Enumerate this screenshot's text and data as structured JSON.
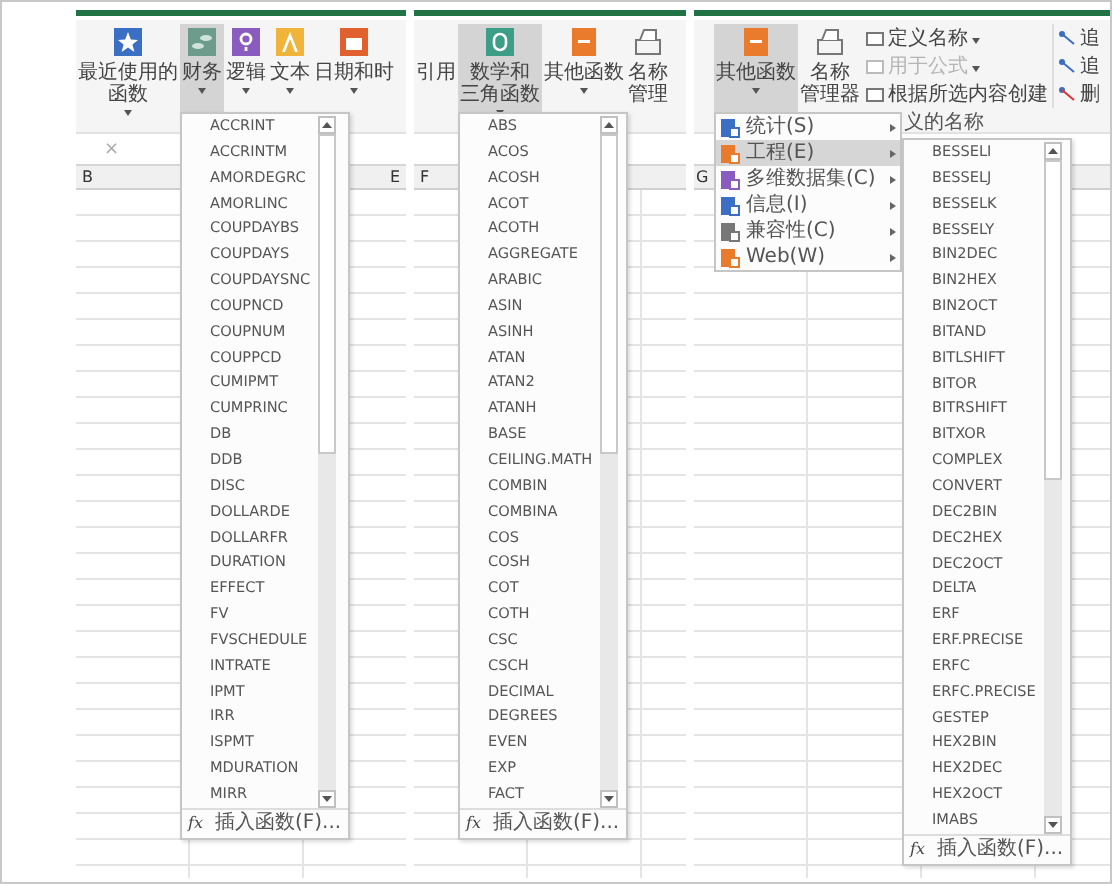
{
  "panels": [
    {
      "ribbon": {
        "buttons": [
          {
            "kind": "recent",
            "lines": [
              "最近使用的",
              "函数"
            ],
            "caret": true,
            "selected": false
          },
          {
            "kind": "financial",
            "lines": [
              "财务"
            ],
            "caret": true,
            "selected": true
          },
          {
            "kind": "logical",
            "lines": [
              "逻辑"
            ],
            "caret": true,
            "selected": false
          },
          {
            "kind": "text",
            "lines": [
              "文本"
            ],
            "caret": true,
            "selected": false
          },
          {
            "kind": "date",
            "lines": [
              "日期和时"
            ],
            "caret": true,
            "selected": false
          }
        ]
      },
      "formula_bar": {
        "cancel": "×"
      },
      "column_headers": [
        "B",
        "E"
      ],
      "dropdown": {
        "items": [
          "ACCRINT",
          "ACCRINTM",
          "AMORDEGRC",
          "AMORLINC",
          "COUPDAYBS",
          "COUPDAYS",
          "COUPDAYSNC",
          "COUPNCD",
          "COUPNUM",
          "COUPPCD",
          "CUMIPMT",
          "CUMPRINC",
          "DB",
          "DDB",
          "DISC",
          "DOLLARDE",
          "DOLLARFR",
          "DURATION",
          "EFFECT",
          "FV",
          "FVSCHEDULE",
          "INTRATE",
          "IPMT",
          "IRR",
          "ISPMT",
          "MDURATION",
          "MIRR"
        ],
        "symbol": "fx",
        "footer": "插入函数(F)..."
      }
    },
    {
      "ribbon": {
        "buttons": [
          {
            "kind": "partial",
            "lines": [
              "引用"
            ],
            "caret": false,
            "selected": false
          },
          {
            "kind": "math",
            "lines": [
              "数学和",
              "三角函数"
            ],
            "caret": true,
            "selected": true
          },
          {
            "kind": "other",
            "lines": [
              "其他函数"
            ],
            "caret": true,
            "selected": false
          },
          {
            "kind": "names",
            "lines": [
              "名称",
              "管理"
            ],
            "caret": false,
            "selected": false
          }
        ]
      },
      "column_headers": [
        "F"
      ],
      "dropdown": {
        "items": [
          "ABS",
          "ACOS",
          "ACOSH",
          "ACOT",
          "ACOTH",
          "AGGREGATE",
          "ARABIC",
          "ASIN",
          "ASINH",
          "ATAN",
          "ATAN2",
          "ATANH",
          "BASE",
          "CEILING.MATH",
          "COMBIN",
          "COMBINA",
          "COS",
          "COSH",
          "COT",
          "COTH",
          "CSC",
          "CSCH",
          "DECIMAL",
          "DEGREES",
          "EVEN",
          "EXP",
          "FACT"
        ],
        "symbol": "fx",
        "footer": "插入函数(F)..."
      }
    },
    {
      "ribbon": {
        "buttons": [
          {
            "kind": "other",
            "lines": [
              "其他函数"
            ],
            "caret": true,
            "selected": true
          },
          {
            "kind": "names",
            "lines": [
              "名称",
              "管理器"
            ],
            "caret": false,
            "selected": false
          }
        ],
        "small_buttons": [
          {
            "label": "定义名称",
            "caret": true,
            "disabled": false
          },
          {
            "label": "用于公式",
            "caret": true,
            "disabled": true
          },
          {
            "label": "根据所选内容创建",
            "caret": false,
            "disabled": false
          }
        ],
        "group_label": "义的名称",
        "trace_buttons": [
          "追",
          "追",
          "删"
        ]
      },
      "column_headers": [
        "G"
      ],
      "submenu": [
        {
          "kind": "statistical",
          "label": "统计(S)",
          "selected": false
        },
        {
          "kind": "engineering",
          "label": "工程(E)",
          "selected": true
        },
        {
          "kind": "cube",
          "label": "多维数据集(C)",
          "selected": false
        },
        {
          "kind": "information",
          "label": "信息(I)",
          "selected": false
        },
        {
          "kind": "compatibility",
          "label": "兼容性(C)",
          "selected": false
        },
        {
          "kind": "web",
          "label": "Web(W)",
          "selected": false
        }
      ],
      "dropdown": {
        "items": [
          "BESSELI",
          "BESSELJ",
          "BESSELK",
          "BESSELY",
          "BIN2DEC",
          "BIN2HEX",
          "BIN2OCT",
          "BITAND",
          "BITLSHIFT",
          "BITOR",
          "BITRSHIFT",
          "BITXOR",
          "COMPLEX",
          "CONVERT",
          "DEC2BIN",
          "DEC2HEX",
          "DEC2OCT",
          "DELTA",
          "ERF",
          "ERF.PRECISE",
          "ERFC",
          "ERFC.PRECISE",
          "GESTEP",
          "HEX2BIN",
          "HEX2DEC",
          "HEX2OCT",
          "IMABS"
        ],
        "symbol": "fx",
        "footer": "插入函数(F)..."
      }
    }
  ]
}
